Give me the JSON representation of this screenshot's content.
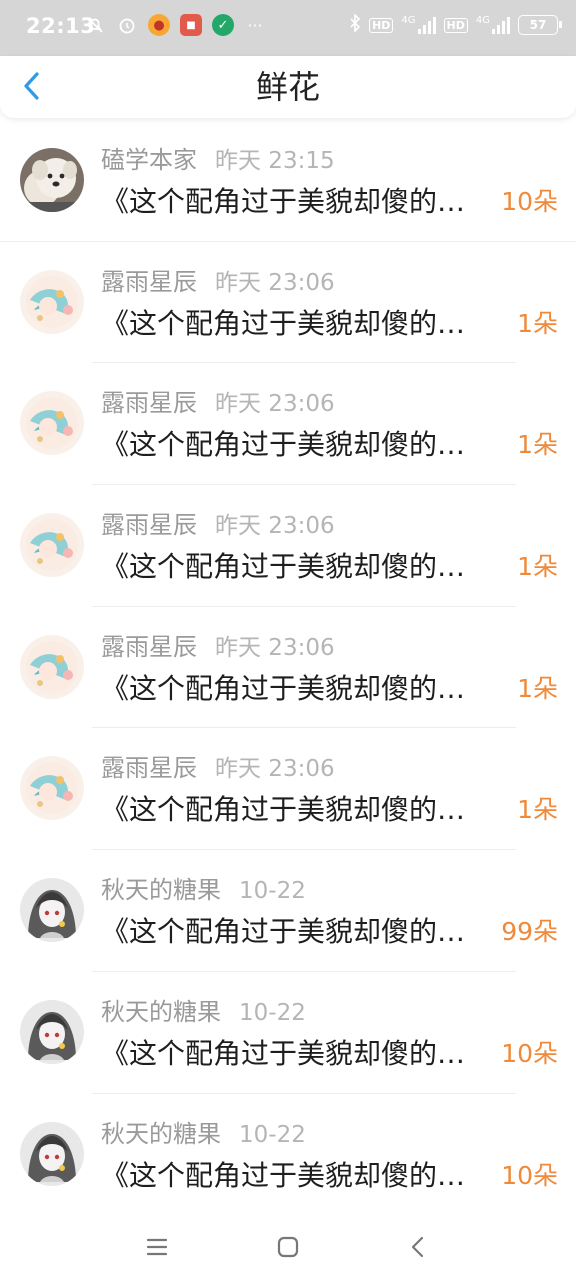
{
  "status_bar": {
    "time": "22:13",
    "left_icons": [
      "mute-bell-icon",
      "alarm-icon",
      "weibo-icon",
      "app-icon",
      "green-app-icon",
      "more-dots-icon"
    ],
    "right_icons": [
      "bluetooth-icon",
      "hd-icon",
      "signal-4g-icon",
      "hd-icon",
      "signal-4g-icon",
      "battery-icon"
    ],
    "network_label": "4G",
    "hd_label": "HD",
    "battery_level": "57",
    "more_dots": "···"
  },
  "header": {
    "title": "鲜花",
    "back_icon": "chevron-left-icon",
    "accent_color": "#2f9be8"
  },
  "records": [
    {
      "user": "磕学本家",
      "time": "昨天 23:15",
      "book": "《这个配角过于美貌却傻的…",
      "flowers": "10朵",
      "avatar": "dog-plush"
    },
    {
      "user": "露雨星辰",
      "time": "昨天 23:06",
      "book": "《这个配角过于美貌却傻的…",
      "flowers": "1朵",
      "avatar": "anime-pastel"
    },
    {
      "user": "露雨星辰",
      "time": "昨天 23:06",
      "book": "《这个配角过于美貌却傻的…",
      "flowers": "1朵",
      "avatar": "anime-pastel"
    },
    {
      "user": "露雨星辰",
      "time": "昨天 23:06",
      "book": "《这个配角过于美貌却傻的…",
      "flowers": "1朵",
      "avatar": "anime-pastel"
    },
    {
      "user": "露雨星辰",
      "time": "昨天 23:06",
      "book": "《这个配角过于美貌却傻的…",
      "flowers": "1朵",
      "avatar": "anime-pastel"
    },
    {
      "user": "露雨星辰",
      "time": "昨天 23:06",
      "book": "《这个配角过于美貌却傻的…",
      "flowers": "1朵",
      "avatar": "anime-pastel"
    },
    {
      "user": "秋天的糖果",
      "time": "10-22",
      "book": "《这个配角过于美貌却傻的…",
      "flowers": "99朵",
      "avatar": "anime-gray"
    },
    {
      "user": "秋天的糖果",
      "time": "10-22",
      "book": "《这个配角过于美貌却傻的…",
      "flowers": "10朵",
      "avatar": "anime-gray"
    },
    {
      "user": "秋天的糖果",
      "time": "10-22",
      "book": "《这个配角过于美貌却傻的…",
      "flowers": "10朵",
      "avatar": "anime-gray"
    }
  ],
  "colors": {
    "flower_count": "#f08a3a",
    "username": "#9a9a9a",
    "status_bar_bg": "#d6d6d6"
  },
  "bottom_nav": {
    "icons": [
      "menu-icon",
      "home-icon",
      "back-icon"
    ]
  }
}
